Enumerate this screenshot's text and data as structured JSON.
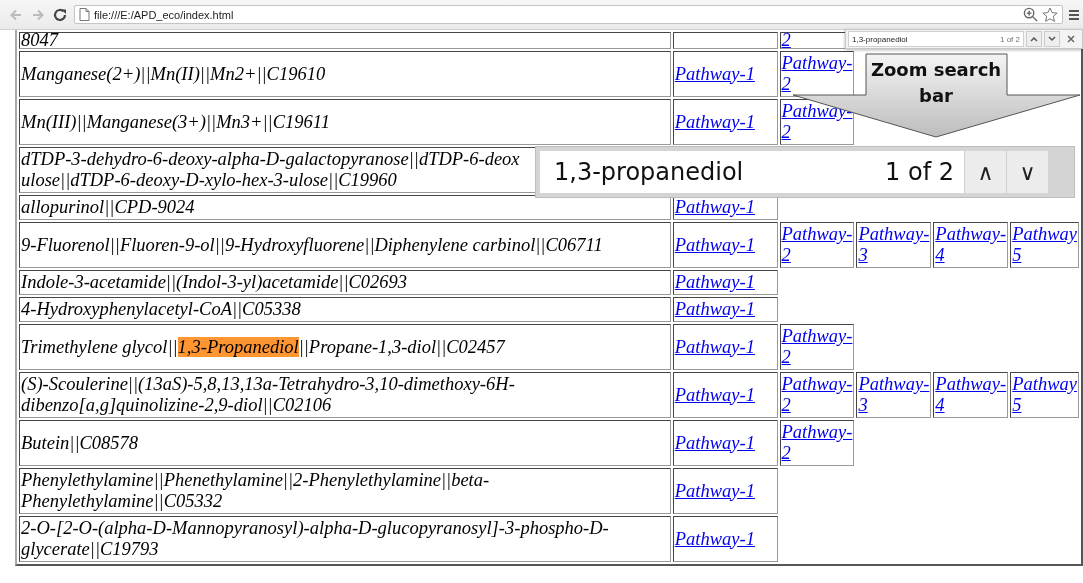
{
  "browser": {
    "address": "file:///E:/APD_eco/index.html",
    "back_disabled": true,
    "forward_disabled": true
  },
  "find_bar": {
    "query": "1,3-propanediol",
    "count": "1 of 2"
  },
  "callout": {
    "text": "Zoom search bar"
  },
  "zoomed_find_bar": {
    "query": "1,3-propanediol",
    "count": "1 of 2",
    "up": "∧",
    "down": "∨"
  },
  "table": {
    "rows": [
      {
        "segments": [
          {
            "text": "8047",
            "highlighted": false
          }
        ],
        "first_pathway_blank": true,
        "pathways": [
          "2"
        ]
      },
      {
        "segments": [
          {
            "text": "Manganese(2+)||Mn(II)||Mn2+||C19610",
            "highlighted": false
          }
        ],
        "first_pathway_blank": false,
        "pathways": [
          "Pathway-1",
          "Pathway-2"
        ]
      },
      {
        "segments": [
          {
            "text": "Mn(III)||Manganese(3+)||Mn3+||C19611",
            "highlighted": false
          }
        ],
        "first_pathway_blank": false,
        "pathways": [
          "Pathway-1",
          "Pathway-2"
        ]
      },
      {
        "segments": [
          {
            "text": "dTDP-3-dehydro-6-deoxy-alpha-D-galactopyranose||dTDP-6-deox\nulose||dTDP-6-deoxy-D-xylo-hex-3-ulose||C19960",
            "highlighted": false
          }
        ],
        "first_pathway_blank": false,
        "pathways": []
      },
      {
        "segments": [
          {
            "text": "allopurinol||CPD-9024",
            "highlighted": false
          }
        ],
        "first_pathway_blank": false,
        "pathways": [
          "Pathway-1"
        ]
      },
      {
        "segments": [
          {
            "text": "9-Fluorenol||Fluoren-9-ol||9-Hydroxyfluorene||Diphenylene carbinol||C06711",
            "highlighted": false
          }
        ],
        "first_pathway_blank": false,
        "pathways": [
          "Pathway-1",
          "Pathway-2",
          "Pathway-3",
          "Pathway-4",
          "Pathway\n5"
        ]
      },
      {
        "segments": [
          {
            "text": "Indole-3-acetamide||(Indol-3-yl)acetamide||C02693",
            "highlighted": false
          }
        ],
        "first_pathway_blank": false,
        "pathways": [
          "Pathway-1"
        ]
      },
      {
        "segments": [
          {
            "text": "4-Hydroxyphenylacetyl-CoA||C05338",
            "highlighted": false
          }
        ],
        "first_pathway_blank": false,
        "pathways": [
          "Pathway-1"
        ]
      },
      {
        "segments": [
          {
            "text": "Trimethylene glycol||",
            "highlighted": false
          },
          {
            "text": "1,3-Propanediol",
            "highlighted": true
          },
          {
            "text": "||Propane-1,3-diol||C02457",
            "highlighted": false
          }
        ],
        "first_pathway_blank": false,
        "pathways": [
          "Pathway-1",
          "Pathway-2"
        ]
      },
      {
        "segments": [
          {
            "text": "(S)-Scoulerine||(13aS)-5,8,13,13a-Tetrahydro-3,10-dimethoxy-6H-\ndibenzo[a,g]quinolizine-2,9-diol||C02106",
            "highlighted": false
          }
        ],
        "first_pathway_blank": false,
        "pathways": [
          "Pathway-1",
          "Pathway-2",
          "Pathway-3",
          "Pathway-4",
          "Pathway\n5"
        ]
      },
      {
        "segments": [
          {
            "text": "Butein||C08578",
            "highlighted": false
          }
        ],
        "first_pathway_blank": false,
        "pathways": [
          "Pathway-1",
          "Pathway-2"
        ]
      },
      {
        "segments": [
          {
            "text": "Phenylethylamine||Phenethylamine||2-Phenylethylamine||beta-\nPhenylethylamine||C05332",
            "highlighted": false
          }
        ],
        "first_pathway_blank": false,
        "pathways": [
          "Pathway-1"
        ]
      },
      {
        "segments": [
          {
            "text": "2-O-[2-O-(alpha-D-Mannopyranosyl)-alpha-D-glucopyranosyl]-3-phospho-D-\nglycerate||C19793",
            "highlighted": false
          }
        ],
        "first_pathway_blank": false,
        "pathways": [
          "Pathway-1"
        ]
      }
    ]
  }
}
